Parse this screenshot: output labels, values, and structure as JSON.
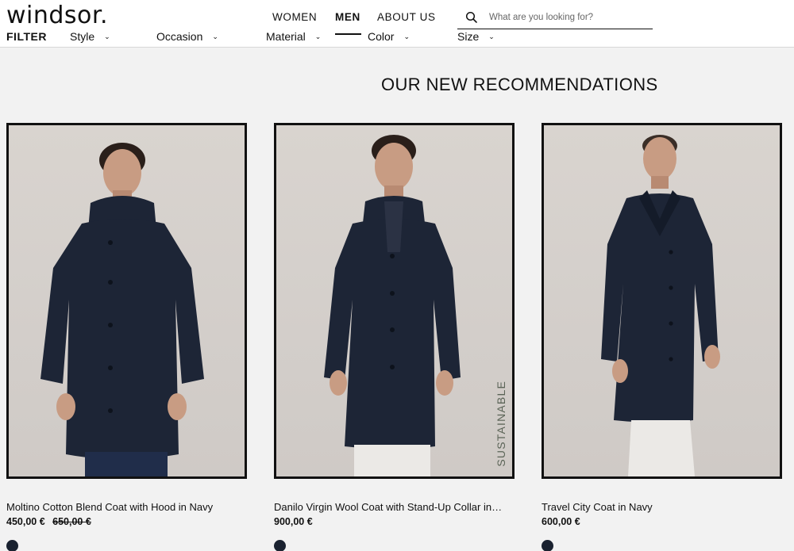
{
  "header": {
    "logo": "windsor.",
    "nav": {
      "women": "WOMEN",
      "men": "MEN",
      "about": "ABOUT US"
    },
    "search": {
      "placeholder": "What are you looking for?"
    }
  },
  "filters": {
    "filter": "FILTER",
    "style": "Style",
    "occasion": "Occasion",
    "material": "Material",
    "color": "Color",
    "size": "Size"
  },
  "section_title": "OUR NEW RECOMMENDATIONS",
  "products": [
    {
      "name": "Moltino Cotton Blend Coat with Hood in Navy",
      "price": "450,00 €",
      "old_price": "650,00 €",
      "swatch_color": "#1a2230"
    },
    {
      "name": "Danilo Virgin Wool Coat with Stand-Up Collar in…",
      "price": "900,00 €",
      "badge": "SUSTAINABLE",
      "swatch_color": "#1a2230"
    },
    {
      "name": "Travel City Coat in Navy",
      "price": "600,00 €",
      "swatch_color": "#1a2230"
    }
  ],
  "colors": {
    "coat_navy": "#1d2536",
    "background": "#f2f2f2",
    "photo_bg": "#d6d1cc"
  }
}
